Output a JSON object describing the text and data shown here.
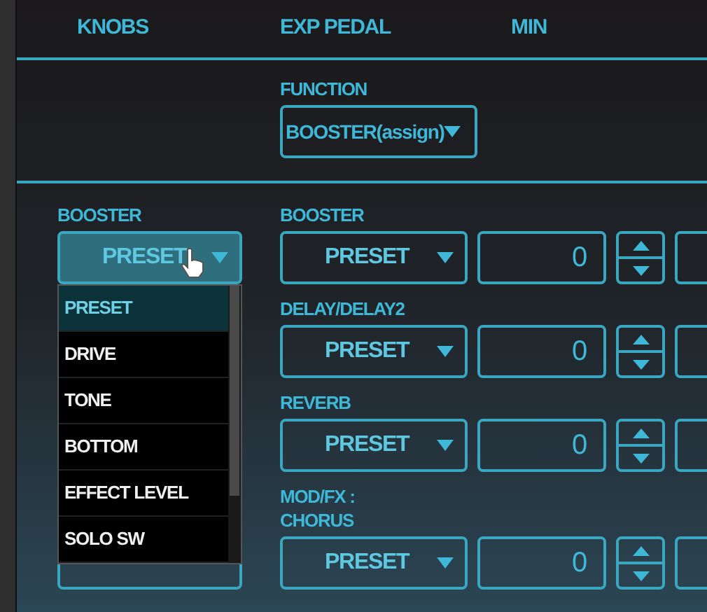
{
  "columns": [
    "KNOBS",
    "EXP PEDAL",
    "MIN"
  ],
  "function": {
    "label": "FUNCTION",
    "value": "BOOSTER(assign)"
  },
  "knob": {
    "label": "BOOSTER",
    "value": "PRESET",
    "expanded": true,
    "options": [
      {
        "label": "PRESET",
        "selected": true
      },
      {
        "label": "DRIVE",
        "selected": false
      },
      {
        "label": "TONE",
        "selected": false
      },
      {
        "label": "BOTTOM",
        "selected": false
      },
      {
        "label": "EFFECT LEVEL",
        "selected": false
      },
      {
        "label": "SOLO SW",
        "selected": false
      }
    ]
  },
  "rows": [
    {
      "label_lines": [
        "BOOSTER"
      ],
      "function": "PRESET",
      "min": "0"
    },
    {
      "label_lines": [
        "DELAY/DELAY2"
      ],
      "function": "PRESET",
      "min": "0"
    },
    {
      "label_lines": [
        "REVERB"
      ],
      "function": "PRESET",
      "min": "0"
    },
    {
      "label_lines": [
        "MOD/FX :",
        "CHORUS"
      ],
      "function": "PRESET",
      "min": "0"
    }
  ]
}
